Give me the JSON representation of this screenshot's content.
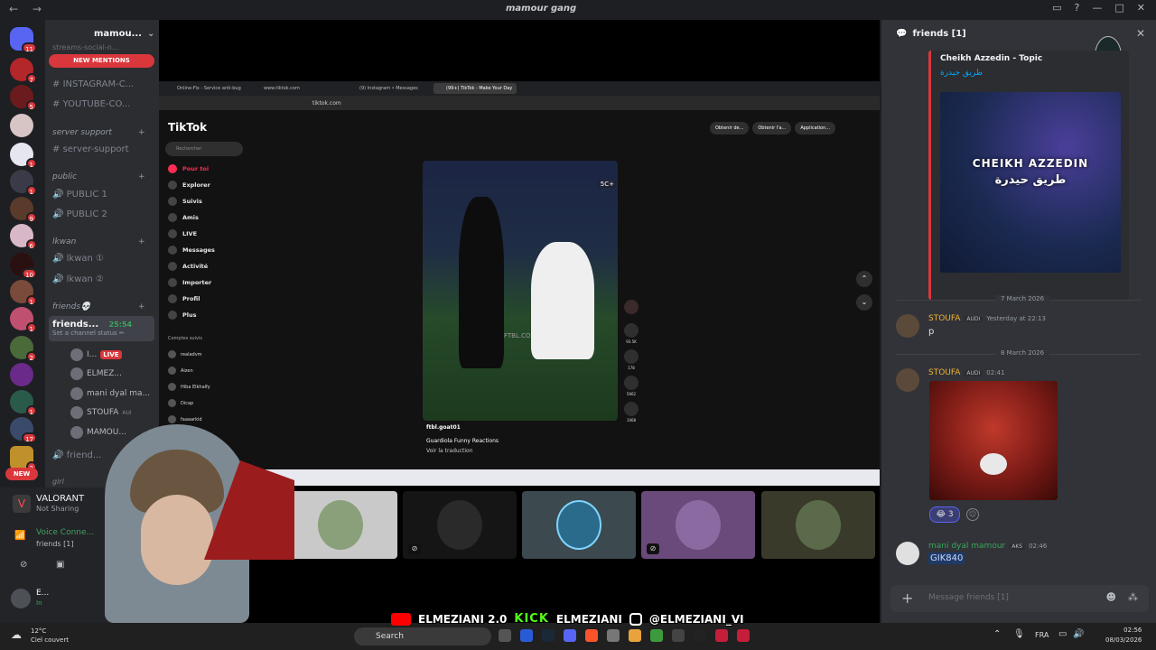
{
  "window": {
    "title": "mamour gang",
    "nav": "← →"
  },
  "server_rail": {
    "badges": [
      "11",
      "7",
      "5",
      "1",
      "1",
      "9",
      "6",
      "10",
      "1",
      "1",
      "2",
      "1",
      "3",
      "1",
      "17",
      "2"
    ]
  },
  "channel_list": {
    "server_name": "mamou...",
    "new_mentions": "NEW MENTIONS",
    "top_text": "streams-social-n...",
    "channels_top": [
      "INSTAGRAM-C...",
      "YOUTUBE-CO..."
    ],
    "category_support": "server support",
    "channel_support": "server-support",
    "category_public": "public",
    "public_channels": [
      "PUBLIC 1",
      "PUBLIC 2"
    ],
    "category_lkwan": "lkwan",
    "lkwan_channels": [
      "lkwan ①",
      "lkwan ②"
    ],
    "category_friends": "friends💀",
    "selected_channel": {
      "name": "friends...",
      "timer": "25:54",
      "status": "Set a channel status ✏"
    },
    "voice_users": [
      {
        "name": "I...",
        "live": "LIVE"
      },
      {
        "name": "ELMEZ..."
      },
      {
        "name": "mani dyal ma..."
      },
      {
        "name": "STOUFA",
        "tag": "AUI"
      },
      {
        "name": "MAMOU..."
      }
    ],
    "friends_channel": "friend...",
    "girl_channel": "girl",
    "new_badge": "NEW"
  },
  "voice_panel": {
    "game": "VALORANT",
    "game_status": "Not Sharing",
    "voice_connected": "Voice Conne...",
    "voice_channel": "friends [1]",
    "user_name": "E...",
    "user_status": "In"
  },
  "browser": {
    "tabs": [
      "Online-Fix - Service anti-bug",
      "www.tiktok.com",
      "(9) Instagram • Messages",
      "(99+) TikTok - Make Your Day"
    ],
    "address": "tiktok.com",
    "top_buttons": [
      "Obtenir de...",
      "Obtenir l'a...",
      "Application..."
    ]
  },
  "tiktok": {
    "logo": "TikTok",
    "search_placeholder": "Rechercher",
    "nav": [
      "Pour toi",
      "Explorer",
      "Suivis",
      "Amis",
      "LIVE",
      "Messages",
      "Activité",
      "Importer",
      "Profil",
      "Plus"
    ],
    "following_header": "Comptes suivis",
    "following": [
      "realadvm",
      "Aizen",
      "Hiba Elkhalfy",
      "Dicap",
      "faaaarkid"
    ],
    "video": {
      "author": "ftbl.goat01",
      "caption": "Guardiola Funny Reactions",
      "translate": "Voir la traduction",
      "watermark": "FTBL.CO",
      "score": "5C+"
    },
    "actions": [
      "93.5K",
      "178",
      "5662",
      "1068"
    ]
  },
  "chat": {
    "channel": "friends [1]",
    "embed": {
      "title": "Cheikh Azzedin - Topic",
      "subtitle": "طريق حيدرة",
      "image_title": "CHEIKH AZZEDIN",
      "image_subtitle": "طريق حيدرة"
    },
    "date1": "7 March 2026",
    "msg1": {
      "author": "STOUFA",
      "tag": "AUDI",
      "time": "Yesterday at 22:13",
      "text": "p"
    },
    "date2": "8 March 2026",
    "msg2": {
      "author": "STOUFA",
      "tag": "AUDI",
      "time": "02:41",
      "reaction_count": "3"
    },
    "msg3": {
      "author": "mani dyal mamour",
      "tag": "AKS",
      "time": "02:46",
      "text": "GIK840"
    },
    "composer_placeholder": "Message friends [1]",
    "colors": {
      "stoufa": "#f0b232",
      "mani": "#3ba55c"
    }
  },
  "taskbar": {
    "weather_temp": "12°C",
    "weather_desc": "Ciel couvert",
    "search": "Search",
    "lang": "FRA",
    "time": "02:56",
    "date": "08/03/2026"
  },
  "overlay": {
    "youtube": "ELMEZIANI 2.0",
    "kick_logo": "KICK",
    "kick": "ELMEZIANI",
    "instagram": "@ELMEZIANI_VI"
  }
}
